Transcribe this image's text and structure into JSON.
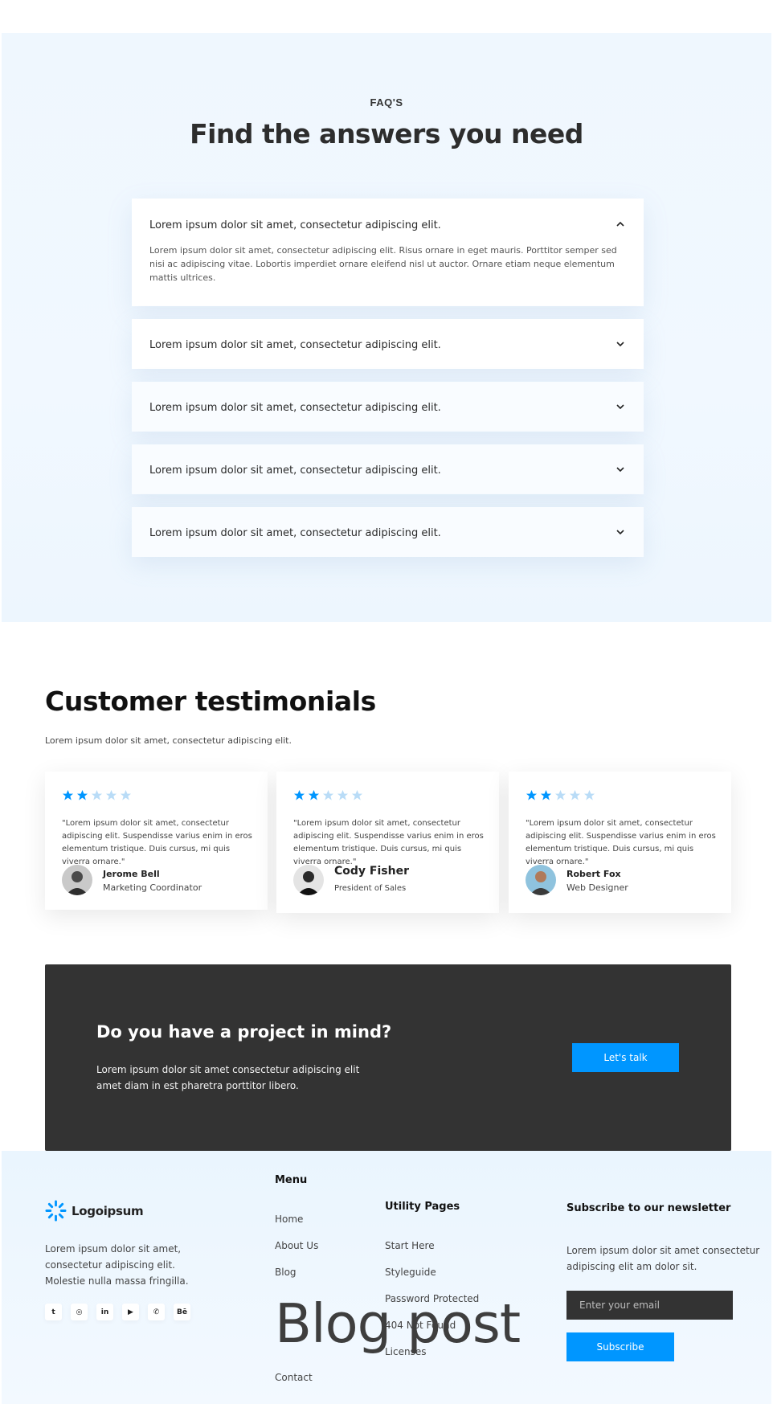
{
  "faq": {
    "eyebrow": "FAQ'S",
    "title": "Find the answers you need",
    "items": [
      {
        "question": "Lorem ipsum dolor sit amet, consectetur adipiscing elit.",
        "answer": "Lorem ipsum dolor sit amet, consectetur adipiscing elit. Risus ornare in eget mauris. Porttitor semper sed nisi ac adipiscing vitae. Lobortis imperdiet ornare eleifend nisl ut auctor. Ornare etiam neque elementum mattis ultrices.",
        "expanded": true
      },
      {
        "question": "Lorem ipsum dolor sit amet, consectetur adipiscing elit.",
        "expanded": false
      },
      {
        "question": "Lorem ipsum dolor sit amet, consectetur adipiscing elit.",
        "expanded": false
      },
      {
        "question": "Lorem ipsum dolor sit amet, consectetur adipiscing elit.",
        "expanded": false
      },
      {
        "question": "Lorem ipsum dolor sit amet, consectetur adipiscing elit.",
        "expanded": false
      }
    ]
  },
  "testimonials": {
    "title": "Customer testimonials",
    "subtitle": "Lorem ipsum dolor sit amet, consectetur adipiscing elit.",
    "rating_filled": 2,
    "rating_total": 5,
    "cards": [
      {
        "quote": "\"Lorem ipsum dolor sit amet, consectetur adipiscing elit. Suspendisse varius enim in eros elementum tristique. Duis cursus, mi quis viverra ornare.\"",
        "name": "Jerome Bell",
        "role": "Marketing Coordinator"
      },
      {
        "quote": "\"Lorem ipsum dolor sit amet, consectetur adipiscing elit. Suspendisse varius enim in eros elementum tristique. Duis cursus, mi quis viverra ornare.\"",
        "name": "Cody Fisher",
        "role": "President of Sales"
      },
      {
        "quote": "\"Lorem ipsum dolor sit amet, consectetur adipiscing elit. Suspendisse varius enim in eros elementum tristique. Duis cursus, mi quis viverra ornare.\"",
        "name": "Robert Fox",
        "role": "Web Designer"
      }
    ]
  },
  "cta": {
    "title": "Do you have a project in mind?",
    "text": "Lorem ipsum dolor sit amet consectetur adipiscing elit amet diam in est pharetra porttitor libero.",
    "button": "Let's talk"
  },
  "footer": {
    "logo_text": "Logoipsum",
    "about": "Lorem ipsum dolor sit amet, consectetur adipiscing elit. Molestie nulla massa fringilla.",
    "socials": [
      "twitter-icon",
      "instagram-icon",
      "linkedin-icon",
      "youtube-icon",
      "whatsapp-icon",
      "behance-icon"
    ],
    "social_glyphs": [
      "t",
      "◎",
      "in",
      "▶",
      "✆",
      "Bē"
    ],
    "menu": {
      "title": "Menu",
      "links": [
        "Home",
        "About Us",
        "Blog",
        "Contact"
      ]
    },
    "utility": {
      "title": "Utility Pages",
      "links": [
        "Start Here",
        "Styleguide",
        "Password Protected",
        "404 Not Found",
        "Licenses"
      ]
    },
    "newsletter": {
      "title": "Subscribe to our newsletter",
      "text": "Lorem ipsum dolor sit amet consectetur adipiscing elit am dolor sit.",
      "placeholder": "Enter your email",
      "button": "Subscribe"
    },
    "overlay_text": "Blog post"
  },
  "colors": {
    "accent": "#0096ff",
    "star_filled": "#0096ff",
    "star_empty": "#b9dcf7",
    "dark": "#333333"
  }
}
